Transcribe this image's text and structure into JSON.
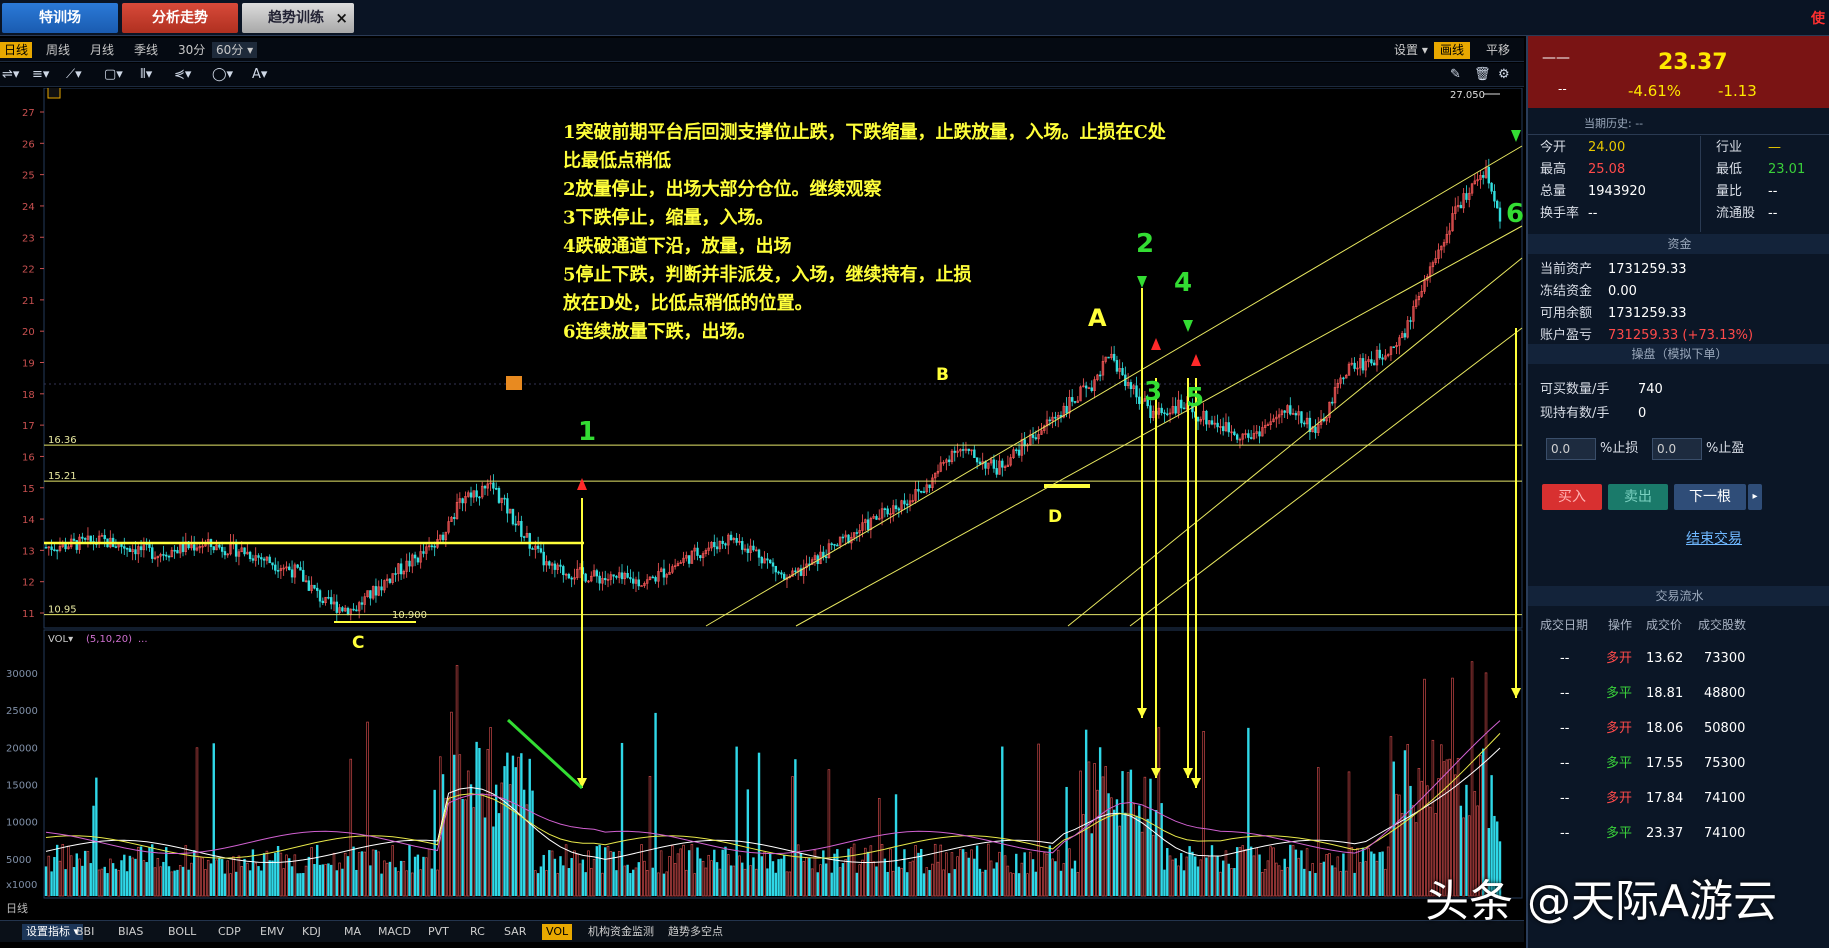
{
  "top_tabs": [
    {
      "label": "特训场"
    },
    {
      "label": "分析走势"
    },
    {
      "label": "趋势训练",
      "close": "×"
    }
  ],
  "top_right_label": "使",
  "periods": [
    "日线",
    "周线",
    "月线",
    "季线",
    "30分",
    "60分"
  ],
  "period_active": "日线",
  "period_dropdown": "60分",
  "period_right": [
    "设置",
    "画线",
    "平移"
  ],
  "period_right_active": "画线",
  "toolbar_text_tool": "A",
  "ygrid_labels": [
    "27",
    "26",
    "25",
    "24",
    "23",
    "22",
    "21",
    "20",
    "19",
    "18",
    "17",
    "16",
    "15",
    "14",
    "13",
    "12",
    "11"
  ],
  "vol_axis_labels": [
    "30000",
    "25000",
    "20000",
    "15000",
    "10000",
    "5000",
    "x1000"
  ],
  "level_labels": {
    "l1636": "16.36",
    "l1521": "15.21",
    "l1095": "10.95",
    "high_mark": "27.050",
    "low_mark": "10.900"
  },
  "vol_title": "VOL",
  "vol_params": "(5,10,20)",
  "vol_suffix": "...",
  "bottom_left_label": "日线",
  "annotation_lines": [
    "1突破前期平台后回测支撑位止跌，下跌缩量，止跌放量，入场。止损在C处",
    "  比最低点稍低",
    "2放量停止，出场大部分仓位。继续观察",
    "3下跌停止，缩量，入场。",
    "4跌破通道下沿，放量，出场",
    "5停止下跌，判断并非派发，入场，继续持有，止损",
    "  放在D处，比低点稍低的位置。",
    "6连续放量下跌，出场。"
  ],
  "chart_markers": [
    "1",
    "2",
    "3",
    "4",
    "5",
    "6",
    "A",
    "B",
    "C",
    "D"
  ],
  "indicator_tabs": [
    "设置指标",
    "BBI",
    "BIAS",
    "BOLL",
    "CDP",
    "EMV",
    "KDJ",
    "MA",
    "MACD",
    "PVT",
    "RC",
    "SAR",
    "VOL",
    "机构资金监测",
    "趋势多空点"
  ],
  "indicator_active": "VOL",
  "price_box": {
    "left_dash": "——",
    "left_dash2": "--",
    "price": "23.37",
    "pct": "-4.61%",
    "change": "-1.13"
  },
  "history_label": "当期历史: --",
  "quote": [
    {
      "label": "今开",
      "value": "24.00",
      "color": "y"
    },
    {
      "label": "最高",
      "value": "25.08",
      "color": "r"
    },
    {
      "label": "总量",
      "value": "1943920",
      "color": "w"
    },
    {
      "label": "换手率",
      "value": "--",
      "color": "w"
    }
  ],
  "quote_right": [
    {
      "label": "行业",
      "value": "—",
      "color": "y"
    },
    {
      "label": "最低",
      "value": "23.01",
      "color": "g"
    },
    {
      "label": "量比",
      "value": "--",
      "color": "w"
    },
    {
      "label": "流通股",
      "value": "--",
      "color": "w"
    }
  ],
  "funds_header": "资金",
  "funds": [
    {
      "label": "当前资产",
      "value": "1731259.33",
      "color": "w"
    },
    {
      "label": "冻结资金",
      "value": "0.00",
      "color": "w"
    },
    {
      "label": "可用余额",
      "value": "1731259.33",
      "color": "w"
    },
    {
      "label": "账户盈亏",
      "value": "731259.33 (+73.13%)",
      "color": "r"
    }
  ],
  "trade_header": "操盘（模拟下单）",
  "trade_fields": [
    {
      "label": "可买数量/手",
      "value": "740"
    },
    {
      "label": "现持有数/手",
      "value": "0"
    }
  ],
  "stop_loss": {
    "value": "0.0",
    "label": "%止损"
  },
  "take_profit": {
    "value": "0.0",
    "label": "%止盈"
  },
  "buttons": {
    "buy": "买入",
    "sell": "卖出",
    "next": "下一根",
    "arrow": "▸"
  },
  "end_trade": "结束交易",
  "flow_header": "交易流水",
  "flow_columns": [
    "成交日期",
    "操作",
    "成交价",
    "成交股数"
  ],
  "flow_rows": [
    {
      "date": "--",
      "op": "多开",
      "price": "13.62",
      "qty": "73300"
    },
    {
      "date": "--",
      "op": "多平",
      "price": "18.81",
      "qty": "48800"
    },
    {
      "date": "--",
      "op": "多开",
      "price": "18.06",
      "qty": "50800"
    },
    {
      "date": "--",
      "op": "多平",
      "price": "17.55",
      "qty": "75300"
    },
    {
      "date": "--",
      "op": "多开",
      "price": "17.84",
      "qty": "74100"
    },
    {
      "date": "--",
      "op": "多平",
      "price": "23.37",
      "qty": "74100"
    }
  ],
  "watermark": "头条 @天际A游云",
  "colors": {
    "up": "#ff5a5a",
    "down": "#33e0e0",
    "accent": "#e8a800",
    "annotation": "#ffff3a",
    "marker": "#33dd33"
  }
}
